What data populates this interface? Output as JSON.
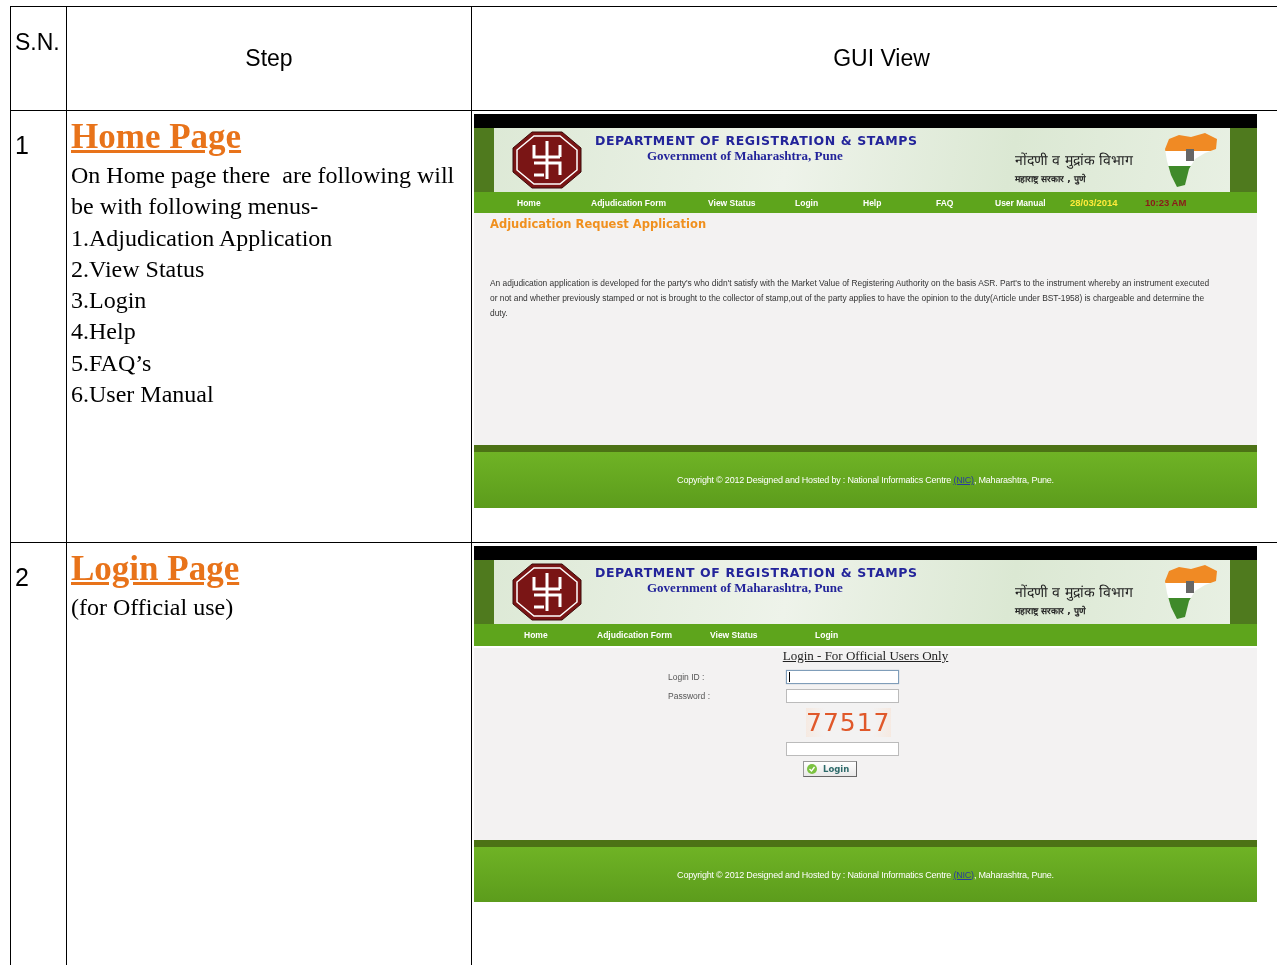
{
  "table": {
    "columns": [
      "S.N.",
      "Step",
      "GUI View"
    ],
    "rows": [
      {
        "number": "1",
        "title": "Home Page",
        "description": "On Home page there  are following will be with following menus-",
        "menu_list": [
          "1.Adjudication Application",
          "2.View Status",
          "3.Login",
          "4.Help",
          "5.FAQ’s",
          "6.User Manual"
        ],
        "screen": {
          "kind": "home",
          "banner": {
            "title": "DEPARTMENT OF REGISTRATION & STAMPS",
            "subtitle": "Government of Maharashtra, Pune",
            "local_title": "नोंदणी व मुद्रांक विभाग",
            "local_subtitle": "महाराष्ट्र सरकार , पुणे"
          },
          "nav": [
            "Home",
            "Adjudication Form",
            "View Status",
            "Login",
            "Help",
            "FAQ",
            "User Manual"
          ],
          "date": "28/03/2014",
          "time": "10:23 AM",
          "heading": "Adjudication Request Application",
          "paragraph": "An adjudication application is developed for the party's who didn't satisfy with the Market Value of Registering Authority on the basis ASR. Part's to the instrument whereby an instrument executed or not and whether previously stamped or not is brought to the collector of stamp,out of the party applies to have the opinion to the duty(Article under BST-1958) is chargeable and determine the duty.",
          "footer": {
            "text": "Copyright © 2012 Designed and Hosted by : National Informatics Centre",
            "link": "(NIC)",
            "after": ", Maharashtra, Pune."
          }
        }
      },
      {
        "number": "2",
        "title": "Login Page",
        "description": "(for Official use)",
        "screen": {
          "kind": "login",
          "banner": {
            "title": "DEPARTMENT OF REGISTRATION & STAMPS",
            "subtitle": "Government of Maharashtra, Pune",
            "local_title": "नोंदणी व मुद्रांक विभाग",
            "local_subtitle": "महाराष्ट्र सरकार , पुणे"
          },
          "nav": [
            "Home",
            "Adjudication Form",
            "View Status",
            "Login"
          ],
          "heading": "Login - For Official Users Only",
          "fields": [
            {
              "label": "Login ID :",
              "focused": true
            },
            {
              "label": "Password :",
              "focused": false
            }
          ],
          "captcha": "77517",
          "captcha_input": {
            "focused": false
          },
          "button": "Login",
          "footer": {
            "text": "Copyright © 2012 Designed and Hosted by : National Informatics Centre",
            "link": "(NIC)",
            "after": ", Maharashtra, Pune."
          }
        }
      }
    ]
  }
}
